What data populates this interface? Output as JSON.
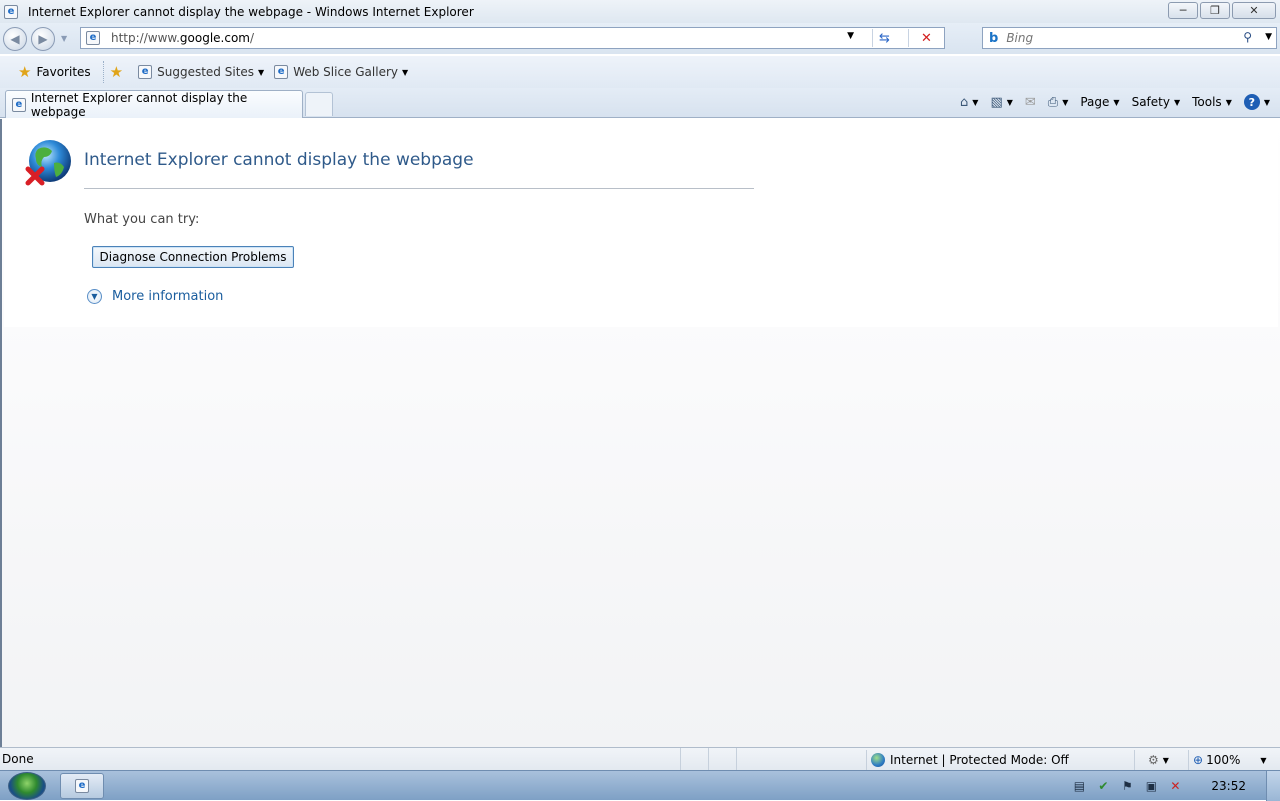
{
  "window": {
    "title": "Internet Explorer cannot display the webpage - Windows Internet Explorer",
    "minimize_glyph": "─",
    "restore_glyph": "❐",
    "close_glyph": "✕"
  },
  "address_bar": {
    "url_prefix": "http://www.",
    "url_domain": "google.com",
    "url_suffix": "/",
    "search_placeholder": "Bing"
  },
  "favorites_bar": {
    "favorites_label": "Favorites",
    "suggested_sites_label": "Suggested Sites",
    "web_slice_gallery_label": "Web Slice Gallery"
  },
  "tabs": [
    {
      "label": "Internet Explorer cannot display the webpage"
    }
  ],
  "command_bar": {
    "page_label": "Page",
    "safety_label": "Safety",
    "tools_label": "Tools"
  },
  "page": {
    "error_title": "Internet Explorer cannot display the webpage",
    "try_text": "What you can try:",
    "diagnose_button": "Diagnose Connection Problems",
    "more_information": "More information"
  },
  "status_bar": {
    "status_text": "Done",
    "zone_text": "Internet | Protected Mode: Off",
    "zoom_text": "100%"
  },
  "taskbar": {
    "clock": "23:52"
  },
  "icons": {
    "back": "back-arrow-icon",
    "forward": "forward-arrow-icon",
    "refresh": "refresh-icon",
    "stop": "stop-icon",
    "search": "search-icon",
    "home": "home-icon",
    "feeds": "feeds-icon",
    "mail": "mail-icon",
    "print": "print-icon",
    "help": "help-icon"
  },
  "colors": {
    "error_title": "#2f5a8a",
    "link": "#1a5d9e",
    "stop_red": "#d32020"
  }
}
